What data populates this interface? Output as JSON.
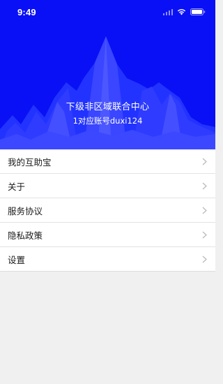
{
  "status_bar": {
    "time": "9:49"
  },
  "banner": {
    "title": "下级非区域联合中心",
    "subtitle": "1对应账号duxi124",
    "background_color": "#0a10f5"
  },
  "menu": {
    "items": [
      {
        "label": "我的互助宝",
        "icon": "chevron-right-icon"
      },
      {
        "label": "关于",
        "icon": "chevron-right-icon"
      },
      {
        "label": "服务协议",
        "icon": "chevron-right-icon"
      },
      {
        "label": "隐私政策",
        "icon": "chevron-right-icon"
      },
      {
        "label": "设置",
        "icon": "chevron-right-icon"
      }
    ]
  }
}
